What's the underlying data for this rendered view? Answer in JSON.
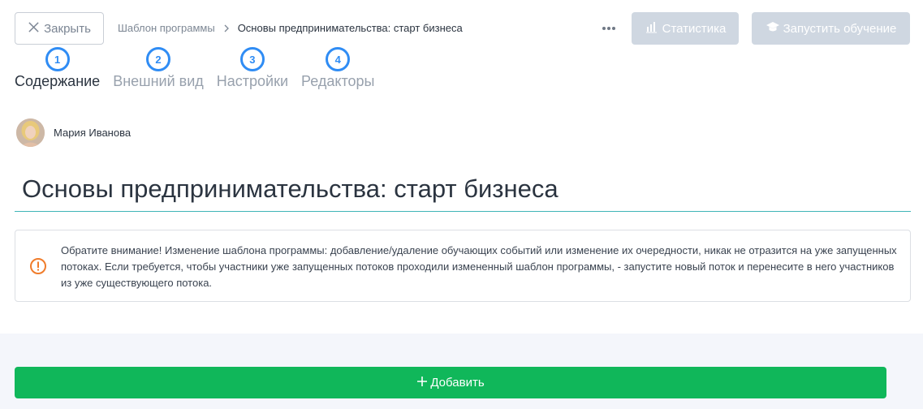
{
  "header": {
    "close_label": "Закрыть",
    "breadcrumb": {
      "parent": "Шаблон программы",
      "current": "Основы предпринимательства: старт бизнеса"
    },
    "statistics_label": "Статистика",
    "launch_label": "Запустить обучение"
  },
  "tabs": [
    {
      "number": "1",
      "label": "Содержание",
      "active": true
    },
    {
      "number": "2",
      "label": "Внешний вид",
      "active": false
    },
    {
      "number": "3",
      "label": "Настройки",
      "active": false
    },
    {
      "number": "4",
      "label": "Редакторы",
      "active": false
    }
  ],
  "author": {
    "name": "Мария Иванова"
  },
  "program": {
    "title": "Основы предпринимательства: старт бизнеса"
  },
  "notice": {
    "text": "Обратите внимание! Изменение шаблона программы: добавление/удаление обучающих событий или изменение их очередности, никак не отразится на уже запущенных потоках. Если требуется, чтобы участники уже запущенных потоков проходили измененный шаблон программы, - запустите новый поток и перенесите в него участников из уже существующего потока."
  },
  "actions": {
    "add_label": "Добавить"
  },
  "colors": {
    "accent": "#2f8cf4",
    "add_button": "#10b75a",
    "disabled_button": "#cfd7e1",
    "warning": "#f07c2b",
    "title_underline": "#3fb5b8"
  }
}
